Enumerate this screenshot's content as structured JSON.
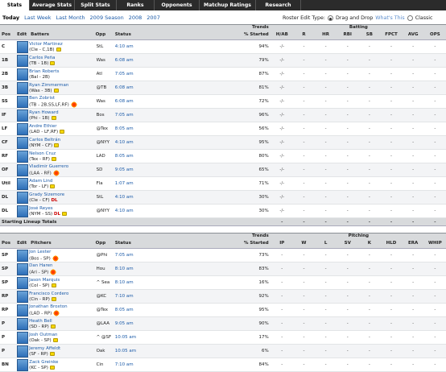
{
  "tabs": [
    "Stats",
    "Average Stats",
    "Split Stats",
    "Ranks",
    "Opponents",
    "Matchup Ratings",
    "Research"
  ],
  "periods": {
    "today": "Today",
    "items": [
      "Last Week",
      "Last Month",
      "2009 Season",
      "2008",
      "2007"
    ]
  },
  "roster_edit": {
    "label": "Roster Edit Type:",
    "opt1": "Drag and Drop",
    "whats_this": "What's This",
    "opt2": "Classic"
  },
  "batting": {
    "group_trends": "Trends",
    "group_stats": "Batting",
    "headers": {
      "pos": "Pos",
      "edit": "Edit",
      "name": "Batters",
      "opp": "Opp",
      "status": "Status",
      "pct": "% Started",
      "stats": [
        "H/AB",
        "R",
        "HR",
        "RBI",
        "SB",
        "FPCT",
        "AVG",
        "OPS"
      ]
    },
    "rows": [
      {
        "pos": "C",
        "name": "Victor Martinez",
        "team": "(Cle - C,1B)",
        "opp": "StL",
        "status": "4:10 am",
        "pct": "94%",
        "icons": [
          "note"
        ],
        "stats": [
          "-/-",
          "-",
          "-",
          "-",
          "-",
          "-",
          "-",
          "-"
        ]
      },
      {
        "pos": "1B",
        "name": "Carlos Peña",
        "team": "(TB - 1B)",
        "opp": "Was",
        "status": "6:08 am",
        "pct": "79%",
        "icons": [
          "note"
        ],
        "stats": [
          "-/-",
          "-",
          "-",
          "-",
          "-",
          "-",
          "-",
          "-"
        ]
      },
      {
        "pos": "2B",
        "name": "Brian Roberts",
        "team": "(Bal - 2B)",
        "opp": "Atl",
        "status": "7:05 am",
        "pct": "87%",
        "icons": [],
        "stats": [
          "-/-",
          "-",
          "-",
          "-",
          "-",
          "-",
          "-",
          "-"
        ]
      },
      {
        "pos": "3B",
        "name": "Ryan Zimmerman",
        "team": "(Was - 3B)",
        "opp": "@TB",
        "status": "6:08 am",
        "pct": "81%",
        "icons": [
          "note"
        ],
        "stats": [
          "-/-",
          "-",
          "-",
          "-",
          "-",
          "-",
          "-",
          "-"
        ]
      },
      {
        "pos": "SS",
        "name": "Ben Zobrist",
        "team": "(TB - 2B,SS,LF,RF)",
        "opp": "Was",
        "status": "6:08 am",
        "pct": "72%",
        "icons": [
          "burst"
        ],
        "stats": [
          "-/-",
          "-",
          "-",
          "-",
          "-",
          "-",
          "-",
          "-"
        ]
      },
      {
        "pos": "IF",
        "name": "Ryan Howard",
        "team": "(Phi - 1B)",
        "opp": "Bos",
        "status": "7:05 am",
        "pct": "96%",
        "icons": [
          "note"
        ],
        "stats": [
          "-/-",
          "-",
          "-",
          "-",
          "-",
          "-",
          "-",
          "-"
        ]
      },
      {
        "pos": "LF",
        "name": "Andre Ethier",
        "team": "(LAD - LF,RF)",
        "opp": "@Tex",
        "status": "8:05 am",
        "pct": "56%",
        "icons": [
          "note"
        ],
        "stats": [
          "-/-",
          "-",
          "-",
          "-",
          "-",
          "-",
          "-",
          "-"
        ]
      },
      {
        "pos": "CF",
        "name": "Carlos Beltrán",
        "team": "(NYM - CF)",
        "opp": "@NYY",
        "status": "4:10 am",
        "pct": "95%",
        "icons": [
          "note"
        ],
        "stats": [
          "-/-",
          "-",
          "-",
          "-",
          "-",
          "-",
          "-",
          "-"
        ]
      },
      {
        "pos": "RF",
        "name": "Nelson Cruz",
        "team": "(Tex - RF)",
        "opp": "LAD",
        "status": "8:05 am",
        "pct": "80%",
        "icons": [
          "note"
        ],
        "stats": [
          "-/-",
          "-",
          "-",
          "-",
          "-",
          "-",
          "-",
          "-"
        ]
      },
      {
        "pos": "OF",
        "name": "Vladimir Guerrero",
        "team": "(LAA - RF)",
        "opp": "SD",
        "status": "9:05 am",
        "pct": "65%",
        "icons": [
          "burst"
        ],
        "stats": [
          "-/-",
          "-",
          "-",
          "-",
          "-",
          "-",
          "-",
          "-"
        ]
      },
      {
        "pos": "Util",
        "name": "Adam Lind",
        "team": "(Tor - LF)",
        "opp": "Fla",
        "status": "1:07 am",
        "pct": "71%",
        "icons": [
          "note"
        ],
        "stats": [
          "-/-",
          "-",
          "-",
          "-",
          "-",
          "-",
          "-",
          "-"
        ]
      },
      {
        "pos": "DL",
        "name": "Grady Sizemore",
        "team": "(Cle - CF)",
        "dl": "DL",
        "opp": "StL",
        "status": "4:10 am",
        "pct": "30%",
        "icons": [],
        "stats": [
          "-/-",
          "-",
          "-",
          "-",
          "-",
          "-",
          "-",
          "-"
        ]
      },
      {
        "pos": "DL",
        "name": "José Reyes",
        "team": "(NYM - SS)",
        "dl": "DL",
        "opp": "@NYY",
        "status": "4:10 am",
        "pct": "30%",
        "icons": [
          "note"
        ],
        "stats": [
          "-/-",
          "-",
          "-",
          "-",
          "-",
          "-",
          "-",
          "-"
        ]
      }
    ],
    "totals_label": "Starting Lineup Totals",
    "totals": [
      "-",
      "-",
      "-",
      "-",
      "-",
      "-",
      "-",
      "-"
    ]
  },
  "pitching": {
    "group_trends": "Trends",
    "group_stats": "Pitching",
    "headers": {
      "pos": "Pos",
      "edit": "Edit",
      "name": "Pitchers",
      "opp": "Opp",
      "status": "Status",
      "pct": "% Started",
      "stats": [
        "IP",
        "W",
        "L",
        "SV",
        "K",
        "HLD",
        "ERA",
        "WHIP"
      ]
    },
    "rows": [
      {
        "pos": "SP",
        "name": "Jon Lester",
        "team": "(Bos - SP)",
        "opp": "@Phi",
        "status": "7:05 am",
        "pct": "73%",
        "icons": [
          "burst"
        ],
        "stats": [
          "-",
          "-",
          "-",
          "-",
          "-",
          "-",
          "-",
          "-"
        ]
      },
      {
        "pos": "SP",
        "name": "Dan Haren",
        "team": "(Ari - SP)",
        "opp": "Hou",
        "status": "8:10 am",
        "pct": "83%",
        "icons": [
          "burst"
        ],
        "stats": [
          "-",
          "-",
          "-",
          "-",
          "-",
          "-",
          "-",
          "-"
        ]
      },
      {
        "pos": "SP",
        "name": "Jason Marquis",
        "team": "(Col - SP)",
        "opp": "^ Sea",
        "status": "8:10 am",
        "pct": "16%",
        "icons": [
          "note"
        ],
        "stats": [
          "-",
          "-",
          "-",
          "-",
          "-",
          "-",
          "-",
          "-"
        ]
      },
      {
        "pos": "RP",
        "name": "Francisco Cordero",
        "team": "(Cin - RP)",
        "opp": "@KC",
        "status": "7:10 am",
        "pct": "92%",
        "icons": [
          "note"
        ],
        "stats": [
          "-",
          "-",
          "-",
          "-",
          "-",
          "-",
          "-",
          "-"
        ]
      },
      {
        "pos": "RP",
        "name": "Jonathan Broxton",
        "team": "(LAD - RP)",
        "opp": "@Tex",
        "status": "8:05 am",
        "pct": "95%",
        "icons": [
          "burst"
        ],
        "stats": [
          "-",
          "-",
          "-",
          "-",
          "-",
          "-",
          "-",
          "-"
        ]
      },
      {
        "pos": "P",
        "name": "Heath Bell",
        "team": "(SD - RP)",
        "opp": "@LAA",
        "status": "9:05 am",
        "pct": "90%",
        "icons": [
          "note"
        ],
        "stats": [
          "-",
          "-",
          "-",
          "-",
          "-",
          "-",
          "-",
          "-"
        ]
      },
      {
        "pos": "P",
        "name": "Josh Outman",
        "team": "(Oak - SP)",
        "opp": "^ @SF",
        "status": "10:05 am",
        "pct": "17%",
        "icons": [
          "note"
        ],
        "stats": [
          "-",
          "-",
          "-",
          "-",
          "-",
          "-",
          "-",
          "-"
        ]
      },
      {
        "pos": "P",
        "name": "Jeremy Affeldt",
        "team": "(SF - RP)",
        "opp": "Oak",
        "status": "10:05 am",
        "pct": "6%",
        "icons": [
          "note"
        ],
        "stats": [
          "-",
          "-",
          "-",
          "-",
          "-",
          "-",
          "-",
          "-"
        ]
      },
      {
        "pos": "BN",
        "name": "Zack Greinke",
        "team": "(KC - SP)",
        "opp": "Cin",
        "status": "7:10 am",
        "pct": "84%",
        "icons": [
          "note"
        ],
        "stats": [
          "-",
          "-",
          "-",
          "-",
          "-",
          "-",
          "-",
          "-"
        ]
      }
    ]
  }
}
